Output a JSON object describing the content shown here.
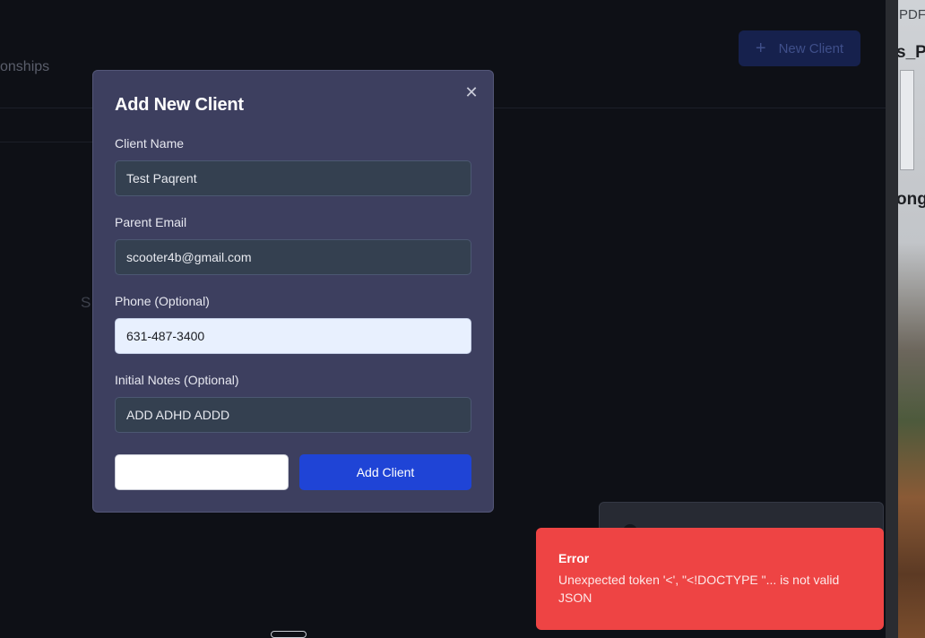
{
  "background": {
    "tab_label": "tionships",
    "new_client_label": "New Client",
    "stray_text": "S"
  },
  "side_panel": {
    "tab_text": "PDF",
    "title_fragment": "s_P",
    "word_fragment": "ong"
  },
  "modal": {
    "title": "Add New Client",
    "fields": [
      {
        "label": "Client Name",
        "value": "Test Paqrent"
      },
      {
        "label": "Parent Email",
        "value": "scooter4b@gmail.com"
      },
      {
        "label": "Phone (Optional)",
        "value": "631-487-3400"
      },
      {
        "label": "Initial Notes (Optional)",
        "value": "ADD ADHD ADDD"
      }
    ],
    "cancel_label": "",
    "submit_label": "Add Client"
  },
  "toast": {
    "title": "Error",
    "message": "Unexpected token '<', \"<!DOCTYPE \"... is not valid JSON"
  },
  "colors": {
    "modal_bg": "#3d3f5f",
    "primary": "#1f44d6",
    "error": "#ee4444",
    "autofill": "#e8f0fe"
  }
}
